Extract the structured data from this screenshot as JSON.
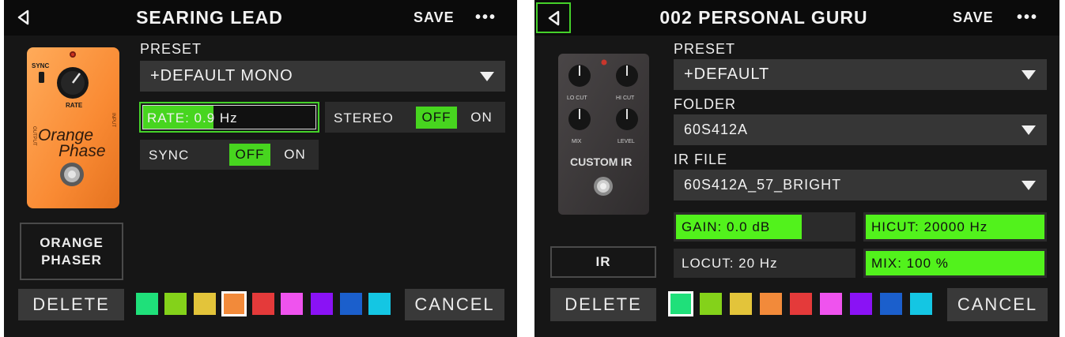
{
  "colors": {
    "accent": "#47d51f",
    "background": "#161616",
    "field": "#363636"
  },
  "left": {
    "title": "SEARING LEAD",
    "save_label": "SAVE",
    "more_label": "•••",
    "preset_label": "PRESET",
    "preset_value": "+DEFAULT MONO",
    "rate_label": "RATE: 0.9 Hz",
    "rate_level": 0.41,
    "stereo_label": "STEREO",
    "stereo_off": "OFF",
    "stereo_on": "ON",
    "sync_label": "SYNC",
    "sync_off": "OFF",
    "sync_on": "ON",
    "model_line1": "ORANGE",
    "model_line2": "PHASER",
    "pedal": {
      "sync": "SYNC",
      "rate": "RATE",
      "output": "OUTPUT",
      "input": "INPUT",
      "brand1": "Orange",
      "brand2": "Phase"
    },
    "delete_label": "DELETE",
    "cancel_label": "CANCEL",
    "swatches": [
      "#1fe07a",
      "#84d21a",
      "#e3c43a",
      "#f28a3a",
      "#e43a3a",
      "#ef53ee",
      "#8a12f5",
      "#1b5fcc",
      "#14c6e3"
    ],
    "selected_swatch": 3
  },
  "right": {
    "title": "002 PERSONAL GURU",
    "save_label": "SAVE",
    "more_label": "•••",
    "preset_label": "PRESET",
    "preset_value": "+DEFAULT",
    "folder_label": "FOLDER",
    "folder_value": "60S412A",
    "irfile_label": "IR FILE",
    "irfile_value": "60S412A_57_BRIGHT",
    "gain_label": "GAIN: 0.0 dB",
    "gain_level": 0.71,
    "hicut_label": "HICUT: 20000 Hz",
    "hicut_level": 1.0,
    "locut_label": "LOCUT: 20 Hz",
    "locut_level": 0.0,
    "mix_label": "MIX: 100 %",
    "mix_level": 1.0,
    "model_label": "IR",
    "pedal": {
      "locut": "LO CUT",
      "hicut": "HI CUT",
      "mix": "MIX",
      "level": "LEVEL",
      "name": "CUSTOM IR"
    },
    "delete_label": "DELETE",
    "cancel_label": "CANCEL",
    "swatches": [
      "#1fe07a",
      "#84d21a",
      "#e3c43a",
      "#f28a3a",
      "#e43a3a",
      "#ef53ee",
      "#8a12f5",
      "#1b5fcc",
      "#14c6e3"
    ],
    "selected_swatch": 0
  }
}
